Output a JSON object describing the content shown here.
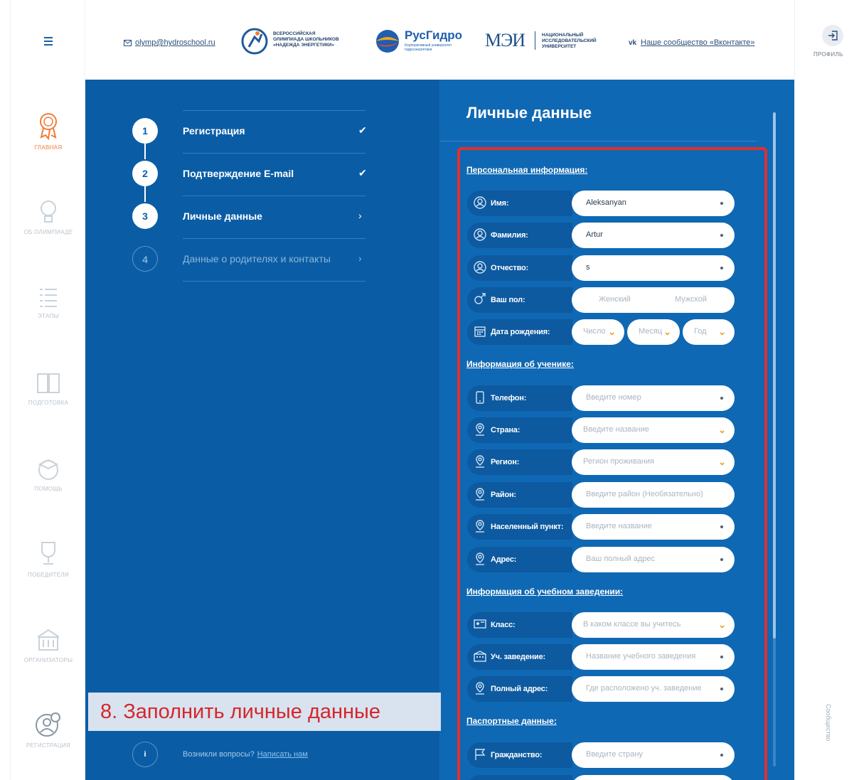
{
  "header": {
    "email": "olymp@hydroschool.ru",
    "logo1_lines": [
      "ВСЕРОССИЙСКАЯ",
      "ОЛИМПИАДА ШКОЛЬНИКОВ",
      "«НАДЕЖДА ЭНЕРГЕТИКИ»"
    ],
    "rushydro_name": "РусГидро",
    "rushydro_sub": "Корпоративный университет гидроэнергетики",
    "mei_name": "МЭИ",
    "mei_lines": [
      "НАЦИОНАЛЬНЫЙ",
      "ИССЛЕДОВАТЕЛЬСКИЙ",
      "УНИВЕРСИТЕТ"
    ],
    "vk_link": "Наше сообщество «Вконтакте»",
    "profile_label": "ПРОФИЛЬ",
    "vk_icon_text": "vk"
  },
  "sidebar": {
    "items": [
      {
        "label": "ГЛАВНАЯ",
        "icon": "award-icon"
      },
      {
        "label": "ОБ ОЛИМПИАДЕ",
        "icon": "lightbulb-icon"
      },
      {
        "label": "ЭТАПЫ",
        "icon": "list-icon"
      },
      {
        "label": "ПОДГОТОВКА",
        "icon": "book-icon"
      },
      {
        "label": "ПОМОЩЬ",
        "icon": "graduation-cap-icon"
      },
      {
        "label": "ПОБЕДИТЕЛИ",
        "icon": "trophy-icon"
      },
      {
        "label": "ОРГАНИЗАТОРЫ",
        "icon": "building-icon"
      },
      {
        "label": "РЕГИСТРАЦИЯ",
        "icon": "user-add-icon"
      }
    ],
    "community_label": "Сообщество"
  },
  "steps": [
    {
      "num": "1",
      "title": "Регистрация",
      "mark": "✔"
    },
    {
      "num": "2",
      "title": "Подтверждение E-mail",
      "mark": "✔"
    },
    {
      "num": "3",
      "title": "Личные данные",
      "mark": "›"
    },
    {
      "num": "4",
      "title": "Данные о родителях и контакты",
      "mark": "›"
    }
  ],
  "help": {
    "icon_text": "i",
    "question": "Возникли вопросы?",
    "link": "Написать нам"
  },
  "overlay_caption": "8. Заполнить личные данные",
  "form": {
    "title": "Личные данные",
    "sections": {
      "personal": "Персональная информация:",
      "student": "Информация об ученике:",
      "school": "Информация об учебном заведении:",
      "passport": "Паспортные данные:"
    },
    "fields": {
      "name": {
        "label": "Имя:",
        "value": "Aleksanyan"
      },
      "surname": {
        "label": "Фамилия:",
        "value": "Artur"
      },
      "patronymic": {
        "label": "Отчество:",
        "value": "s"
      },
      "gender": {
        "label": "Ваш пол:",
        "female": "Женский",
        "male": "Мужской"
      },
      "birthdate": {
        "label": "Дата рождения:",
        "day": "Число",
        "month": "Месяц",
        "year": "Год"
      },
      "phone": {
        "label": "Телефон:",
        "placeholder": "Введите номер"
      },
      "country": {
        "label": "Страна:",
        "placeholder": "Введите название"
      },
      "region": {
        "label": "Регион:",
        "placeholder": "Регион проживания"
      },
      "district": {
        "label": "Район:",
        "placeholder": "Введите район (Необязательно)"
      },
      "locality": {
        "label": "Населенный пункт:",
        "placeholder": "Введите название"
      },
      "address": {
        "label": "Адрес:",
        "placeholder": "Ваш полный адрес"
      },
      "grade": {
        "label": "Класс:",
        "placeholder": "В каком классе вы учитесь"
      },
      "school": {
        "label": "Уч. заведение:",
        "placeholder": "Название учебного заведения"
      },
      "school_address": {
        "label": "Полный адрес:",
        "placeholder": "Где расположено уч. заведение"
      },
      "citizenship": {
        "label": "Гражданство:",
        "placeholder": "Введите страну"
      }
    }
  },
  "colors": {
    "primary": "#0a5da5",
    "accent": "#f07c3a",
    "highlight": "#e32f2f"
  }
}
